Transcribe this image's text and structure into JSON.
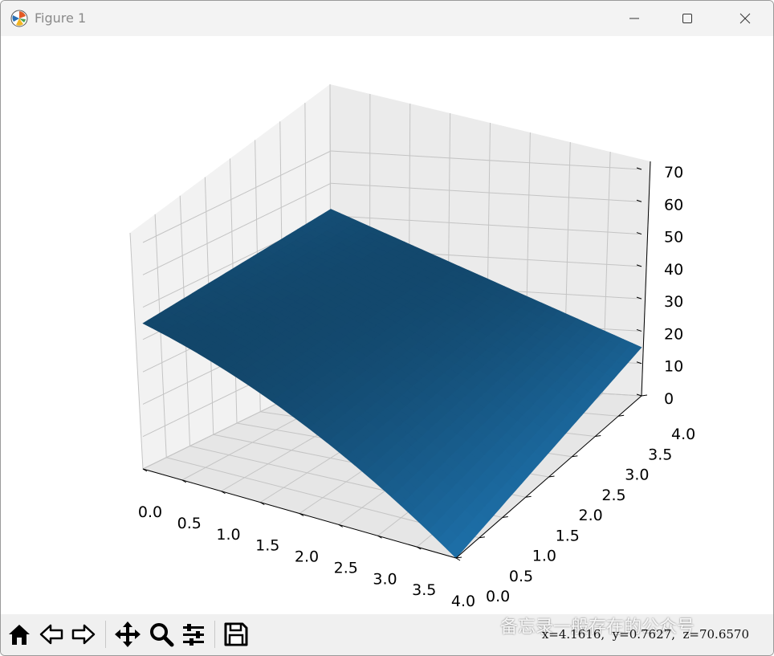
{
  "window": {
    "title": "Figure 1"
  },
  "figure": {
    "z_ticks": [
      "0",
      "10",
      "20",
      "30",
      "40",
      "50",
      "60",
      "70"
    ],
    "x_ticks": [
      "0.0",
      "0.5",
      "1.0",
      "1.5",
      "2.0",
      "2.5",
      "3.0",
      "3.5",
      "4.0"
    ],
    "y_ticks": [
      "0.0",
      "0.5",
      "1.0",
      "1.5",
      "2.0",
      "2.5",
      "3.0",
      "3.5",
      "4.0"
    ],
    "surface_color": "#1f77b4",
    "pane_color": "#f2f2f2",
    "grid_color": "#c4c4c4"
  },
  "chart_data": {
    "type": "surface3d",
    "x_range": [
      0,
      4
    ],
    "y_range": [
      0,
      4
    ],
    "zlim": [
      0,
      70
    ],
    "grid": true,
    "color": "#1f77b4",
    "corner_values": [
      {
        "x": 0,
        "y": 4,
        "z": 52
      },
      {
        "x": 0,
        "y": 0,
        "z": 45
      },
      {
        "x": 4,
        "y": 0,
        "z": 0
      },
      {
        "x": 4,
        "y": 4,
        "z": 15
      }
    ]
  },
  "toolbar": {
    "buttons": [
      "home-icon",
      "back-icon",
      "forward-icon",
      "pan-icon",
      "zoom-icon",
      "configure-icon",
      "save-icon"
    ],
    "coords": "x=4.1616,  y=0.7627,  z=70.6570",
    "watermark": "备忘录一般存在的公众号"
  }
}
